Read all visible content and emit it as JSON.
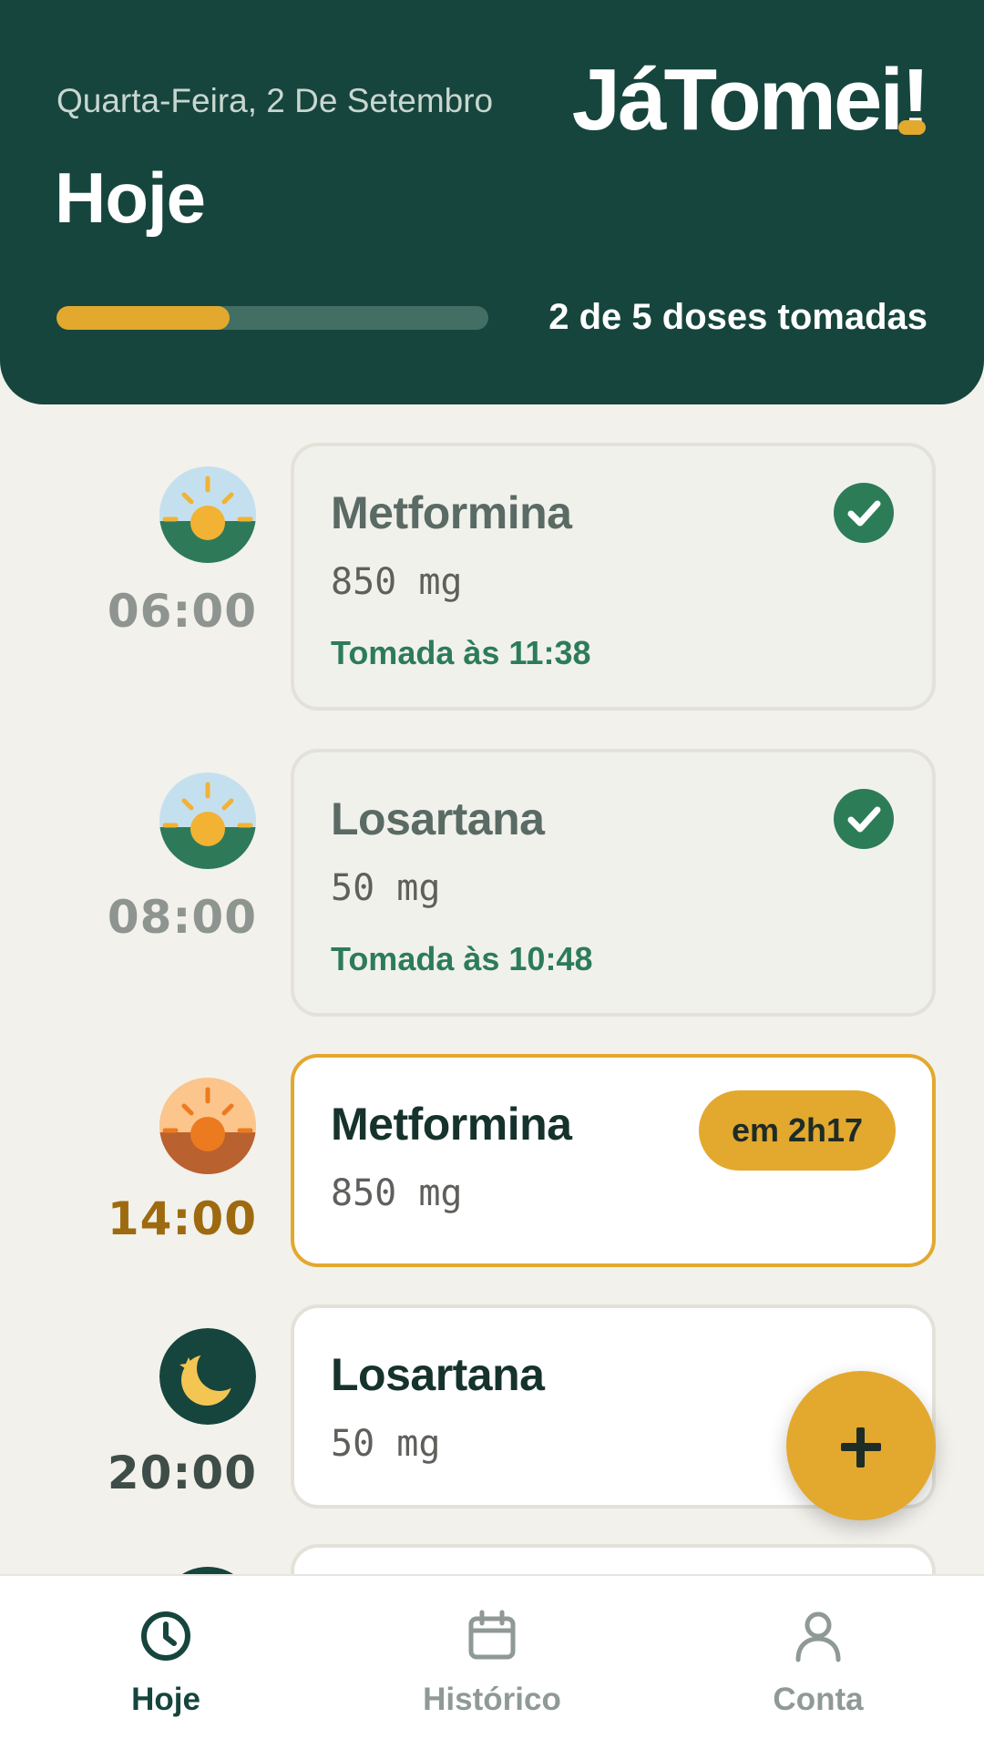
{
  "header": {
    "date": "Quarta-Feira, 2 De Setembro",
    "app_name": "JáTomei!",
    "title": "Hoje",
    "progress_text": "2 de 5 doses tomadas",
    "progress_fraction": 0.4
  },
  "doses": [
    {
      "time": "06:00",
      "icon": "sunrise-icon",
      "name": "Metformina",
      "dose": "850 mg",
      "status": "Tomada às 11:38"
    },
    {
      "time": "08:00",
      "icon": "sunrise-icon",
      "name": "Losartana",
      "dose": "50 mg",
      "status": "Tomada às 10:48"
    },
    {
      "time": "14:00",
      "icon": "afternoon-sun-icon",
      "name": "Metformina",
      "dose": "850 mg",
      "badge": "em 2h17"
    },
    {
      "time": "20:00",
      "icon": "moon-icon",
      "name": "Losartana",
      "dose": "50 mg"
    }
  ],
  "fab": {
    "icon": "plus-icon"
  },
  "nav": [
    {
      "label": "Hoje",
      "icon": "clock-icon",
      "active": true
    },
    {
      "label": "Histórico",
      "icon": "calendar-icon",
      "active": false
    },
    {
      "label": "Conta",
      "icon": "user-icon",
      "active": false
    }
  ],
  "colors": {
    "primary_dark": "#16453d",
    "accent": "#e3a82e",
    "success": "#2d7c58",
    "background": "#f2f1ec"
  }
}
